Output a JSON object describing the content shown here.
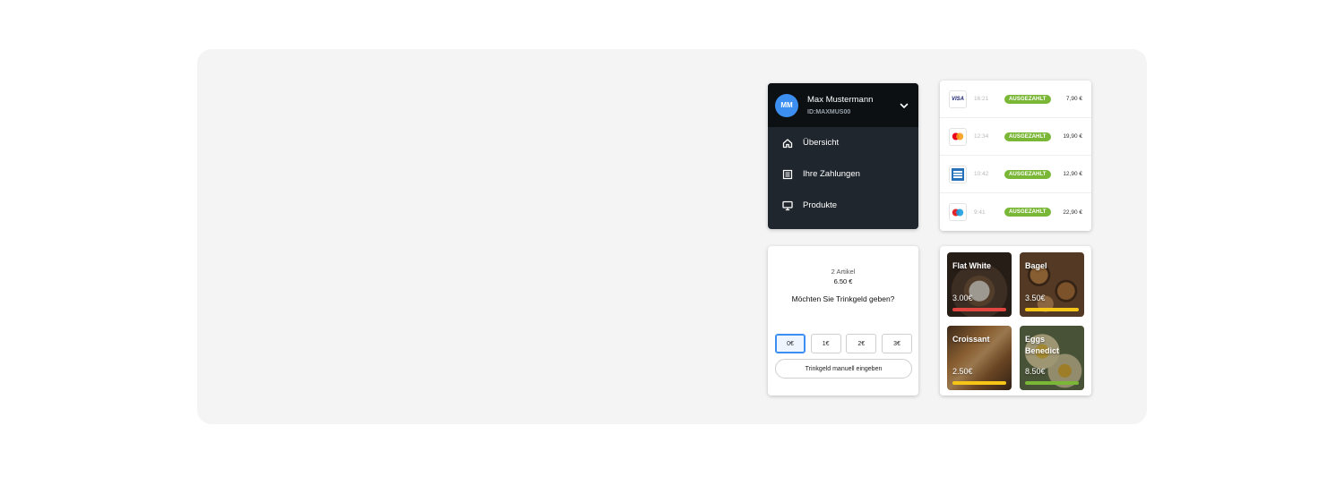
{
  "user": {
    "initials": "MM",
    "name": "Max Mustermann",
    "id": "ID:MAXMUS00"
  },
  "nav": {
    "items": [
      {
        "label": "Übersicht",
        "icon": "home-icon"
      },
      {
        "label": "Ihre Zahlungen",
        "icon": "list-icon"
      },
      {
        "label": "Produkte",
        "icon": "monitor-icon"
      }
    ]
  },
  "transactions": [
    {
      "method": "visa",
      "method_label": "VISA",
      "time": "16:21",
      "status": "AUSGEZAHLT",
      "amount": "7,90 €"
    },
    {
      "method": "mastercard",
      "time": "12:34",
      "status": "AUSGEZAHLT",
      "amount": "19,90 €"
    },
    {
      "method": "amex",
      "time": "10:42",
      "status": "AUSGEZAHLT",
      "amount": "12,90 €"
    },
    {
      "method": "maestro",
      "time": "9:41",
      "status": "AUSGEZAHLT",
      "amount": "22,90 €"
    }
  ],
  "tip": {
    "item_count": "2 Artikel",
    "total": "6.50 €",
    "question": "Möchten Sie Trinkgeld geben?",
    "options": [
      "0€",
      "1€",
      "2€",
      "3€"
    ],
    "selected": "0€",
    "manual_label": "Trinkgeld manuell eingeben"
  },
  "products": [
    {
      "name": "Flat White",
      "price": "3.00€",
      "bar_color": "#e0463f"
    },
    {
      "name": "Bagel",
      "price": "3.50€",
      "bar_color": "#f5c518"
    },
    {
      "name": "Croissant",
      "price": "2.50€",
      "bar_color": "#f5c518"
    },
    {
      "name": "Eggs Benedict",
      "price": "8.50€",
      "bar_color": "#7ab737"
    }
  ],
  "colors": {
    "accent": "#3c8ff0",
    "status_paid": "#7ab737",
    "nav_bg": "#1f262d"
  }
}
